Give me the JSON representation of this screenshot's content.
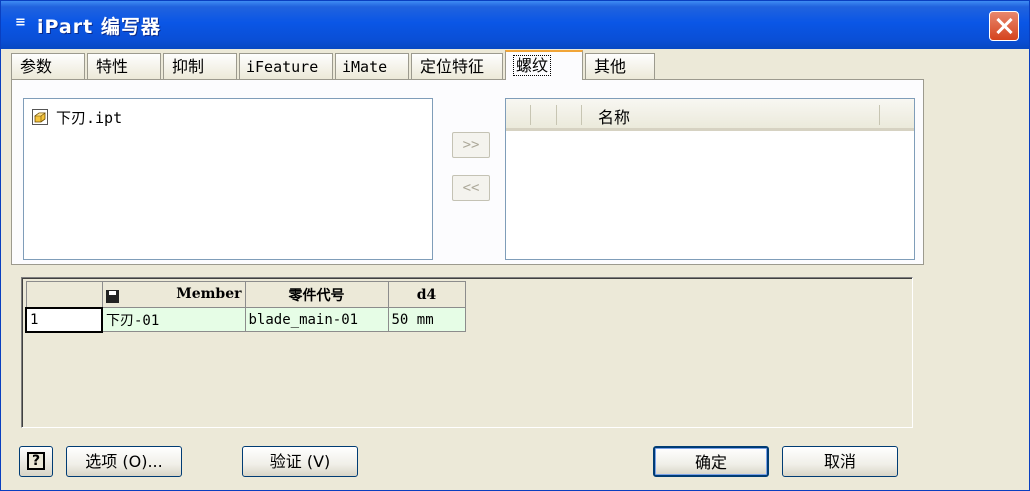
{
  "window": {
    "title": "iPart 编写器",
    "title_icon": "≡"
  },
  "tabs": [
    {
      "label": "参数"
    },
    {
      "label": "特性"
    },
    {
      "label": "抑制"
    },
    {
      "label": "iFeature"
    },
    {
      "label": "iMate"
    },
    {
      "label": "定位特征"
    },
    {
      "label": "螺纹"
    },
    {
      "label": "其他"
    }
  ],
  "active_tab": "螺纹",
  "left_list": {
    "items": [
      {
        "label": "下刃.ipt",
        "icon": "part-file-icon"
      }
    ]
  },
  "move_buttons": {
    "add": ">>",
    "remove": "<<"
  },
  "right_list": {
    "header": "名称",
    "items": []
  },
  "table": {
    "headers": [
      "",
      "Member",
      "零件代号",
      "d4"
    ],
    "rows": [
      {
        "num": "1",
        "member": "下刃-01",
        "part_number": "blade_main-01",
        "d4": "50 mm"
      }
    ]
  },
  "buttons": {
    "options": "选项 (O)...",
    "verify": "验证 (V)",
    "ok": "确定",
    "cancel": "取消"
  },
  "colors": {
    "title_bar": "#0a56e6",
    "active_tab_accent": "#f1a538",
    "row_bg": "#e6fde6"
  }
}
